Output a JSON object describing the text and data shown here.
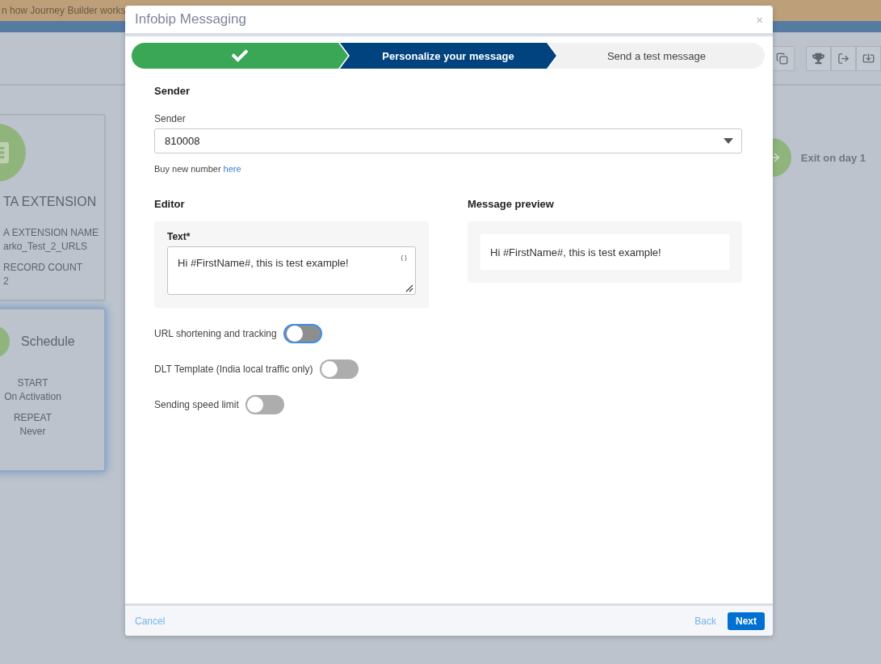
{
  "banner": {
    "text": "n how Journey Builder works"
  },
  "canvas": {
    "cards": [
      {
        "kind": "data",
        "title": "TA EXTENSION",
        "fields": [
          {
            "label": "A EXTENSION NAME",
            "value": "arko_Test_2_URLS"
          },
          {
            "label": "RECORD COUNT",
            "value": "2"
          }
        ],
        "selected": false
      },
      {
        "kind": "schedule",
        "title": "Schedule",
        "fields": [
          {
            "label": "START",
            "value": "On Activation"
          },
          {
            "label": "REPEAT",
            "value": "Never"
          }
        ],
        "selected": true
      }
    ],
    "exit": {
      "label": "Exit on day 1"
    }
  },
  "modal": {
    "title": "Infobip Messaging",
    "close": "×",
    "steps": [
      {
        "kind": "done"
      },
      {
        "kind": "active",
        "label": "Personalize your message"
      },
      {
        "kind": "todo",
        "label": "Send a test message"
      }
    ],
    "sender": {
      "heading": "Sender",
      "label": "Sender",
      "value": "810008",
      "hint": "Buy new number",
      "link": "here"
    },
    "editor": {
      "heading": "Editor",
      "label": "Text*",
      "value": "Hi #FirstName#, this is test example!",
      "braces": "{ }"
    },
    "preview": {
      "heading": "Message preview",
      "text": "Hi #FirstName#, this is test example!"
    },
    "toggles": [
      {
        "label": "URL shortening and tracking",
        "on": false,
        "focused": true
      },
      {
        "label": "DLT Template (India local traffic only)",
        "on": false,
        "focused": false
      },
      {
        "label": "Sending speed limit",
        "on": false,
        "focused": false
      }
    ],
    "footer": {
      "cancel": "Cancel",
      "back": "Back",
      "next": "Next"
    }
  }
}
